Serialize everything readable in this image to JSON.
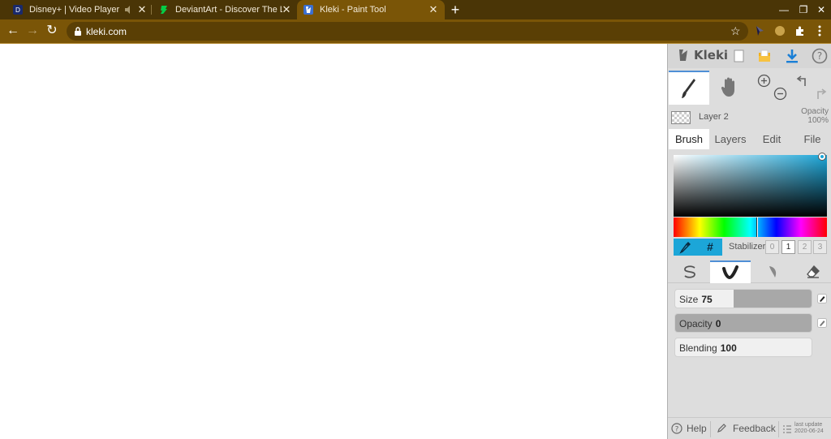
{
  "browser": {
    "tabs": [
      {
        "title": "Disney+ | Video Player",
        "icon": "disney-plus-icon"
      },
      {
        "title": "DeviantArt - Discover The Larges",
        "icon": "deviantart-icon"
      },
      {
        "title": "Kleki - Paint Tool",
        "icon": "kleki-icon",
        "active": true
      }
    ],
    "url": "kleki.com",
    "colors": {
      "tabstrip": "#4a3506",
      "toolbar": "#7a5507"
    }
  },
  "kleki": {
    "logo_text": "Kleki",
    "layer": {
      "name": "Layer 2",
      "opacity_label": "Opacity",
      "opacity_value": "100%"
    },
    "tabs": [
      "Brush",
      "Layers",
      "Edit",
      "File"
    ],
    "active_tab": "Brush",
    "color": {
      "current": "#1ca6d8",
      "hex_symbol": "#"
    },
    "stabilizer": {
      "label": "Stabilizer",
      "options": [
        "0",
        "1",
        "2",
        "3"
      ],
      "selected": "1"
    },
    "sliders": {
      "size": {
        "label": "Size",
        "value": "75",
        "fraction": 0.57
      },
      "opacity": {
        "label": "Opacity",
        "value": "0",
        "fraction": 1.0
      },
      "blending": {
        "label": "Blending",
        "value": "100",
        "fraction": 0.0
      }
    },
    "footer": {
      "help": "Help",
      "feedback": "Feedback",
      "last_update_label": "last update",
      "last_update_date": "2020-06-24"
    }
  }
}
